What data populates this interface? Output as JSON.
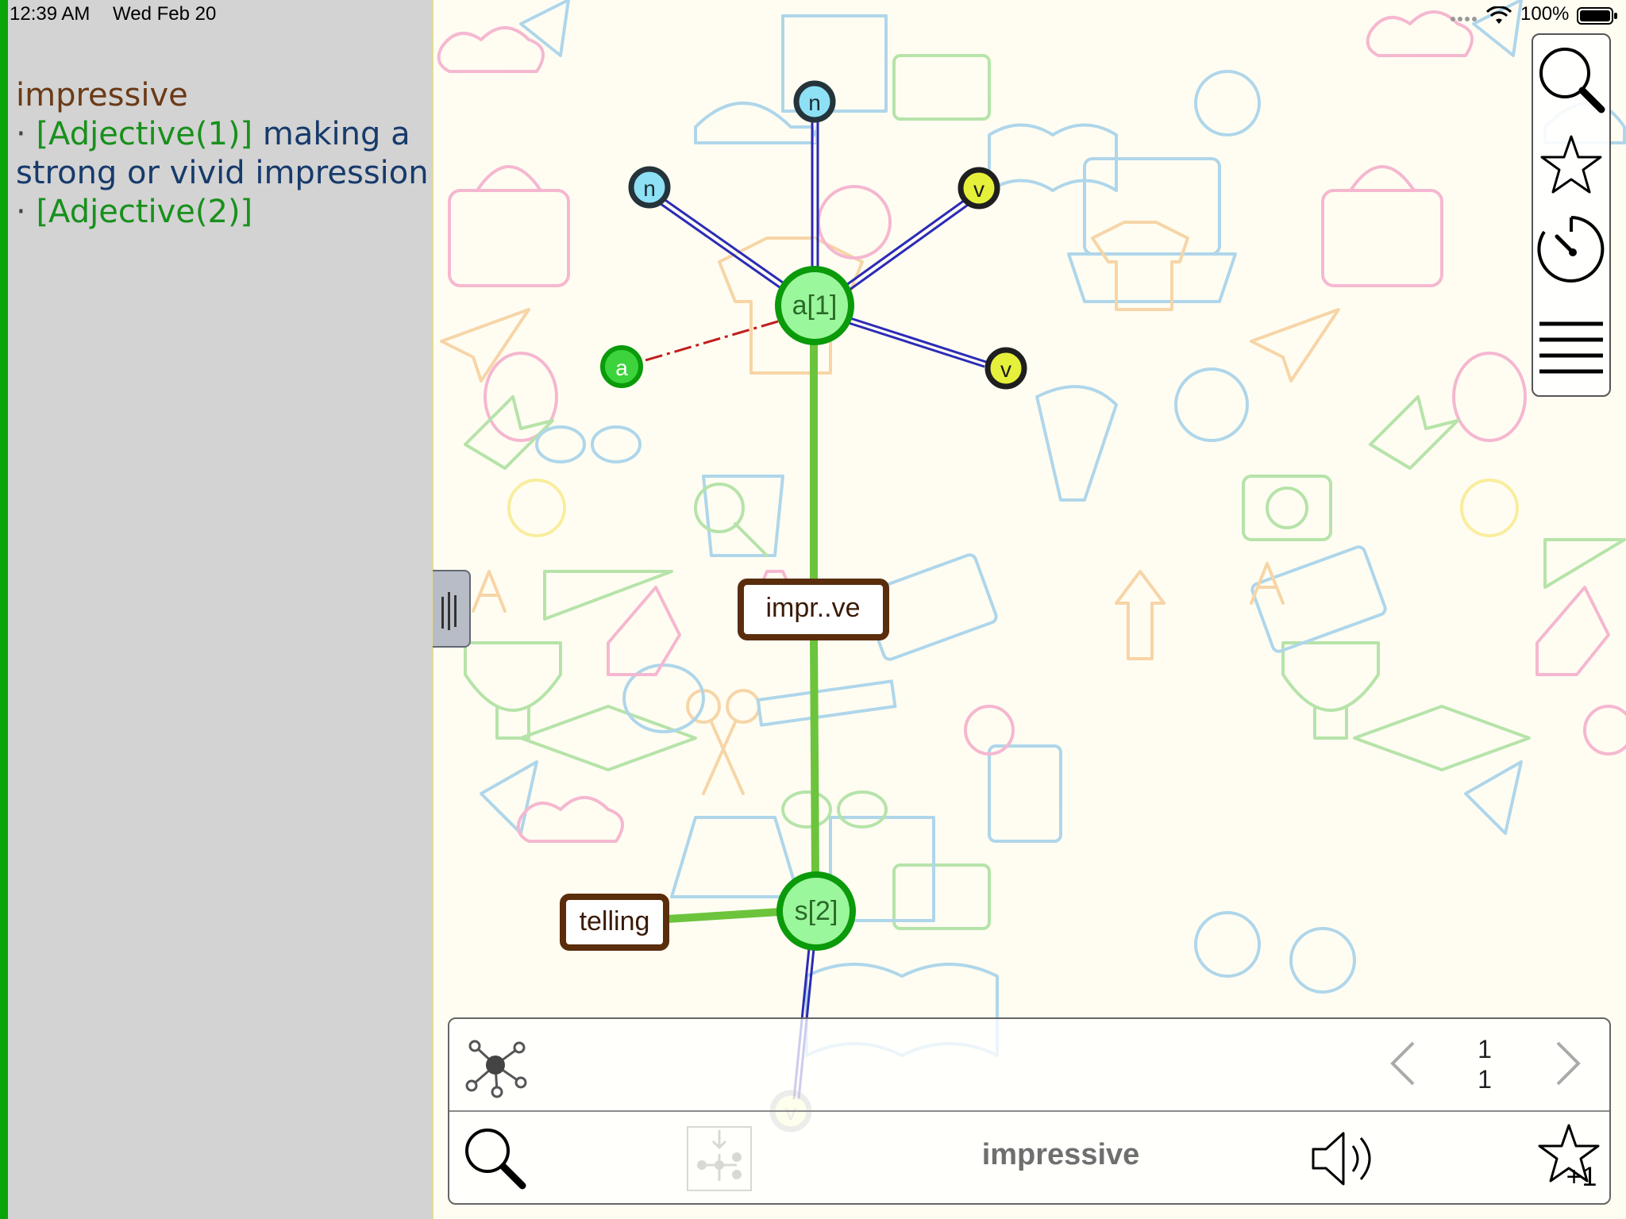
{
  "status_bar": {
    "time": "12:39 AM",
    "date": "Wed Feb 20",
    "battery": "100%",
    "icons": [
      "cellular-dots-icon",
      "wifi-icon",
      "battery-icon"
    ]
  },
  "definition": {
    "word": "impressive",
    "entries": [
      {
        "bullet": "·",
        "pos": "[Adjective(1)]",
        "text": " making a strong or vivid impression"
      },
      {
        "bullet": "·",
        "pos": "[Adjective(2)]",
        "text": ""
      }
    ]
  },
  "graph": {
    "nodes": [
      {
        "id": "a1",
        "label": "a[1]"
      },
      {
        "id": "s2",
        "label": "s[2]"
      },
      {
        "id": "n_top",
        "label": "n"
      },
      {
        "id": "n_left",
        "label": "n"
      },
      {
        "id": "v_upper",
        "label": "v"
      },
      {
        "id": "v_right",
        "label": "v"
      },
      {
        "id": "a_left",
        "label": "a"
      },
      {
        "id": "v_bottom",
        "label": "v"
      }
    ],
    "boxes": [
      {
        "id": "word_box",
        "label": "impr..ve"
      },
      {
        "id": "telling_box",
        "label": "telling"
      }
    ]
  },
  "right_toolbar": {
    "buttons": [
      "search-icon",
      "star-icon",
      "timer-icon",
      "menu-icon"
    ]
  },
  "bottom_panel": {
    "word": "impressive",
    "page_current": "1",
    "page_total": "1",
    "icons": [
      "graph-network-icon",
      "search-icon",
      "tree-add-icon",
      "speaker-icon",
      "star-plus-icon"
    ],
    "star_badge": "+1"
  },
  "colors": {
    "node_green": "#3cd33c",
    "node_green_dark": "#0a9a0a",
    "node_green_fill": "#9bf79b",
    "box_border": "#5a2d0c",
    "edge_green": "#6cc43c",
    "edge_blue": "#2b2bb6",
    "edge_red": "#c01e1e",
    "small_node_blue": "#8ee0f5",
    "small_node_yellow": "#e5f03a"
  }
}
